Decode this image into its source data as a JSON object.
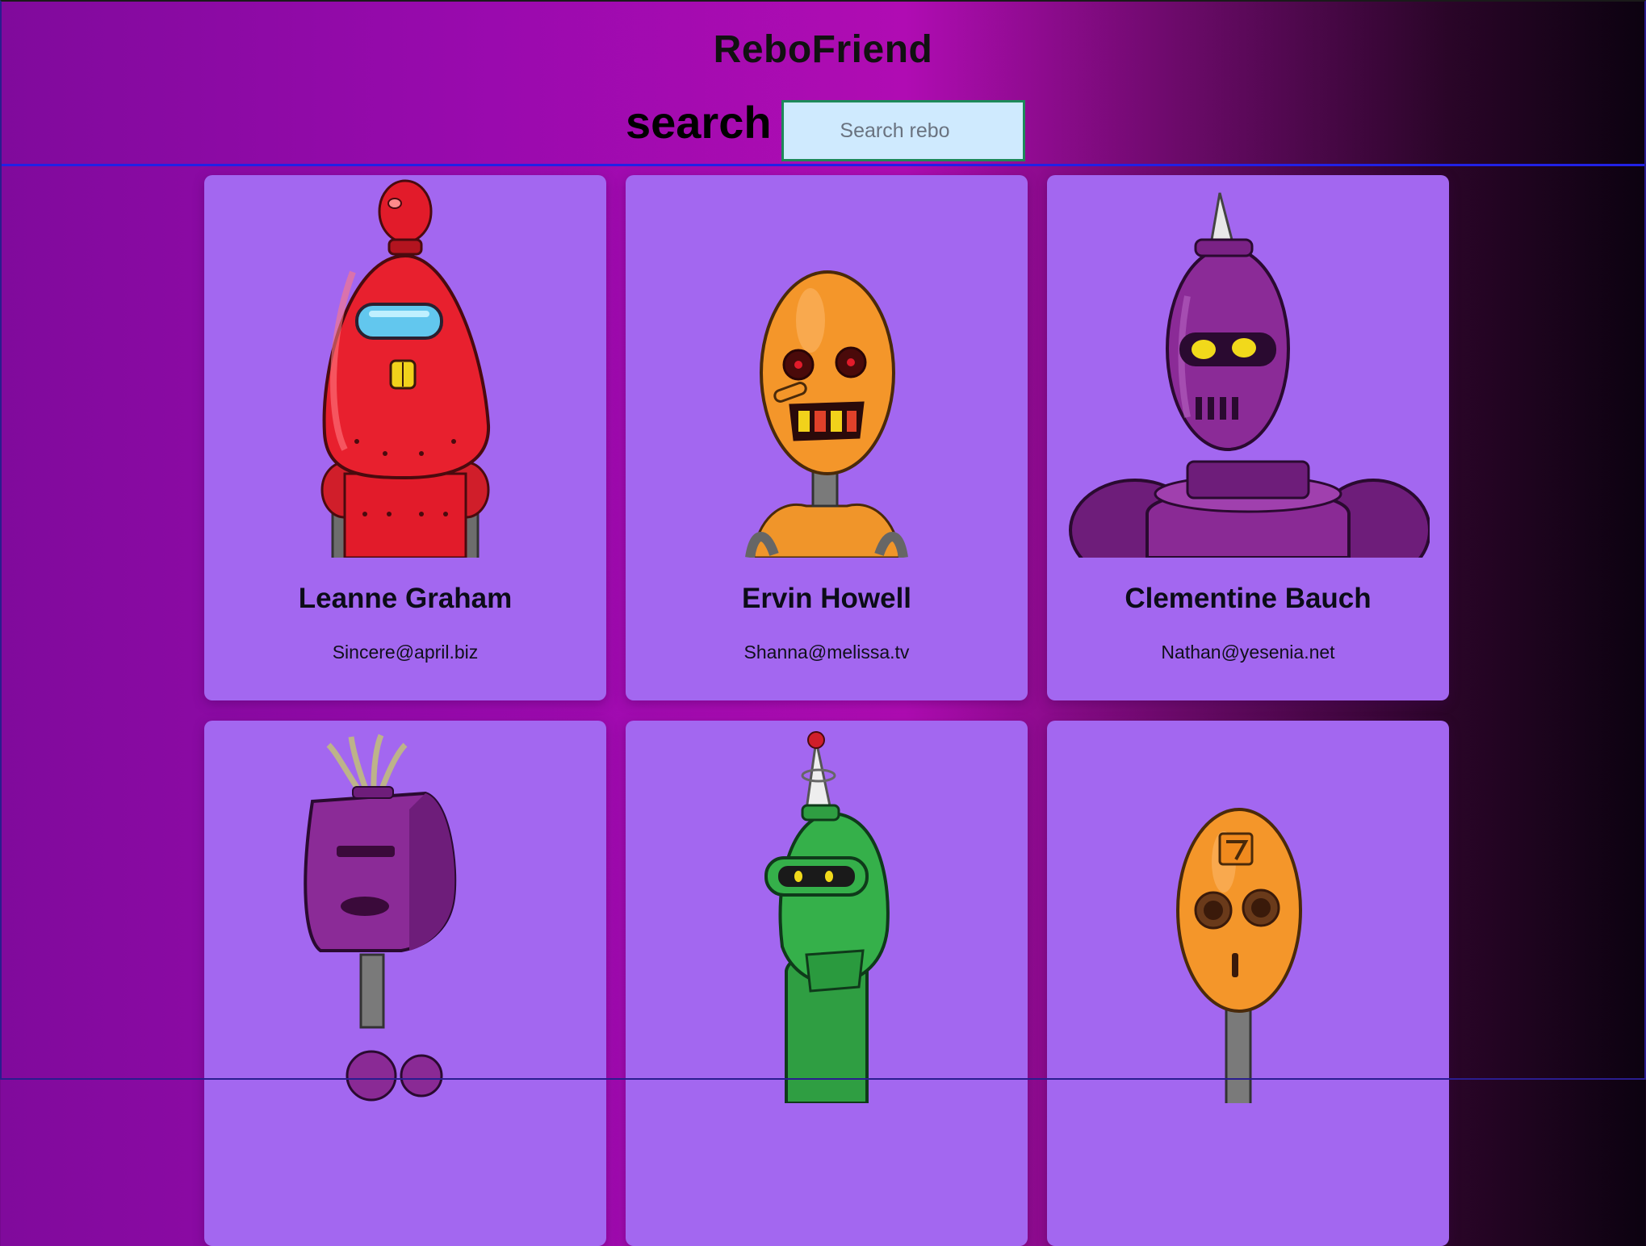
{
  "header": {
    "title": "ReboFriend",
    "search_label": "search",
    "search_placeholder": "Search rebo",
    "search_value": ""
  },
  "robots": [
    {
      "name": "Leanne Graham",
      "email": "Sincere@april.biz",
      "avatar": "red-robot-avatar"
    },
    {
      "name": "Ervin Howell",
      "email": "Shanna@melissa.tv",
      "avatar": "orange-robot-avatar"
    },
    {
      "name": "Clementine Bauch",
      "email": "Nathan@yesenia.net",
      "avatar": "purple-robot-avatar"
    },
    {
      "name": "",
      "email": "",
      "avatar": "purple-box-robot-avatar"
    },
    {
      "name": "",
      "email": "",
      "avatar": "green-robot-avatar"
    },
    {
      "name": "",
      "email": "",
      "avatar": "orange-seven-robot-avatar"
    }
  ],
  "colors": {
    "card": "#a367f0",
    "search_bg": "#cfeafe",
    "search_border": "#1d8a5a",
    "divider": "#2121e6"
  }
}
